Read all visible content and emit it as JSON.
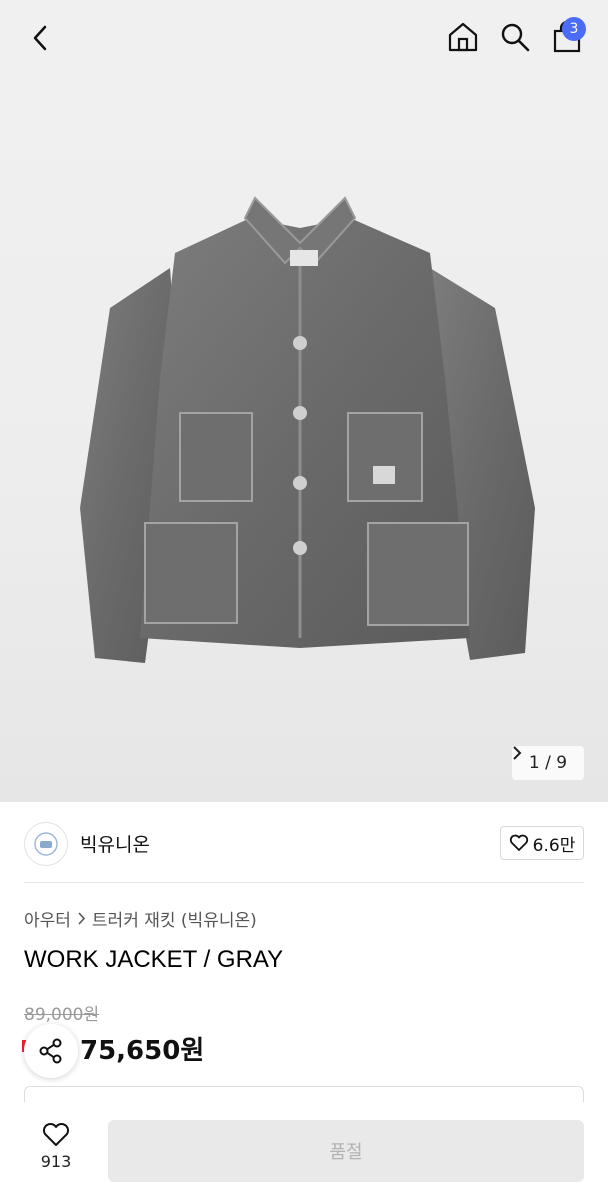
{
  "header": {
    "cart_count": "3",
    "icons": [
      "chevron-left-icon",
      "home-icon",
      "search-icon",
      "shopping-bag-icon"
    ]
  },
  "gallery": {
    "current": "1",
    "total": "9",
    "counter_text": "1 / 9"
  },
  "brand": {
    "name": "빅유니온",
    "likes": "6.6만"
  },
  "product": {
    "breadcrumb": [
      "아우터",
      "트러커 재킷 (빅유니온)"
    ],
    "title": "WORK JACKET / GRAY",
    "original_price": "89,000원",
    "sale_price": "75,650원"
  },
  "footer": {
    "wish_count": "913",
    "cta_label": "품절"
  },
  "colors": {
    "accent_badge": "#4a6cf7",
    "disabled_bg": "#e9e9e9",
    "disabled_text": "#b2b2b2"
  }
}
